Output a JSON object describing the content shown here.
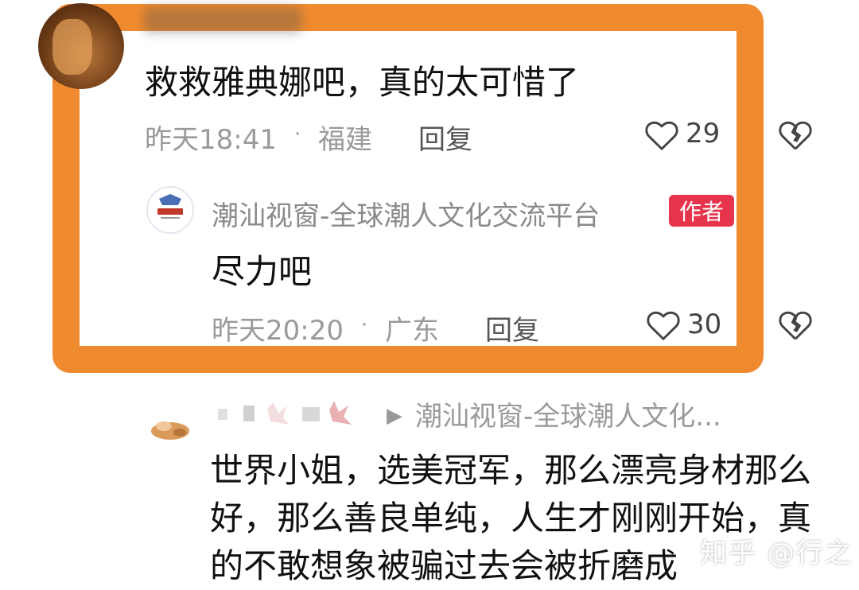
{
  "thread": {
    "comment1": {
      "text": "救救雅典娜吧，真的太可惜了",
      "time": "昨天18:41",
      "separator": "·",
      "location": "福建",
      "reply_label": "回复",
      "likes": "29"
    },
    "author_reply": {
      "username": "潮汕视窗-全球潮人文化交流平台",
      "badge": "作者",
      "text": "尽力吧",
      "time": "昨天20:20",
      "separator": "·",
      "location": "广东",
      "reply_label": "回复",
      "likes": "30"
    },
    "comment3": {
      "arrow": "▶",
      "reply_to": "潮汕视窗-全球潮人文化...",
      "text": "世界小姐，选美冠军，那么漂亮身材那么好，那么善良单纯，人生才刚刚开始，真的不敢想象被骗过去会被折磨成"
    }
  },
  "watermark": "知乎 @行之",
  "colors": {
    "highlight_frame": "#f08a2e",
    "author_badge": "#e5344b",
    "meta_text": "#9a9a9a"
  },
  "icons": [
    "heart-outline-icon",
    "broken-heart-icon"
  ]
}
